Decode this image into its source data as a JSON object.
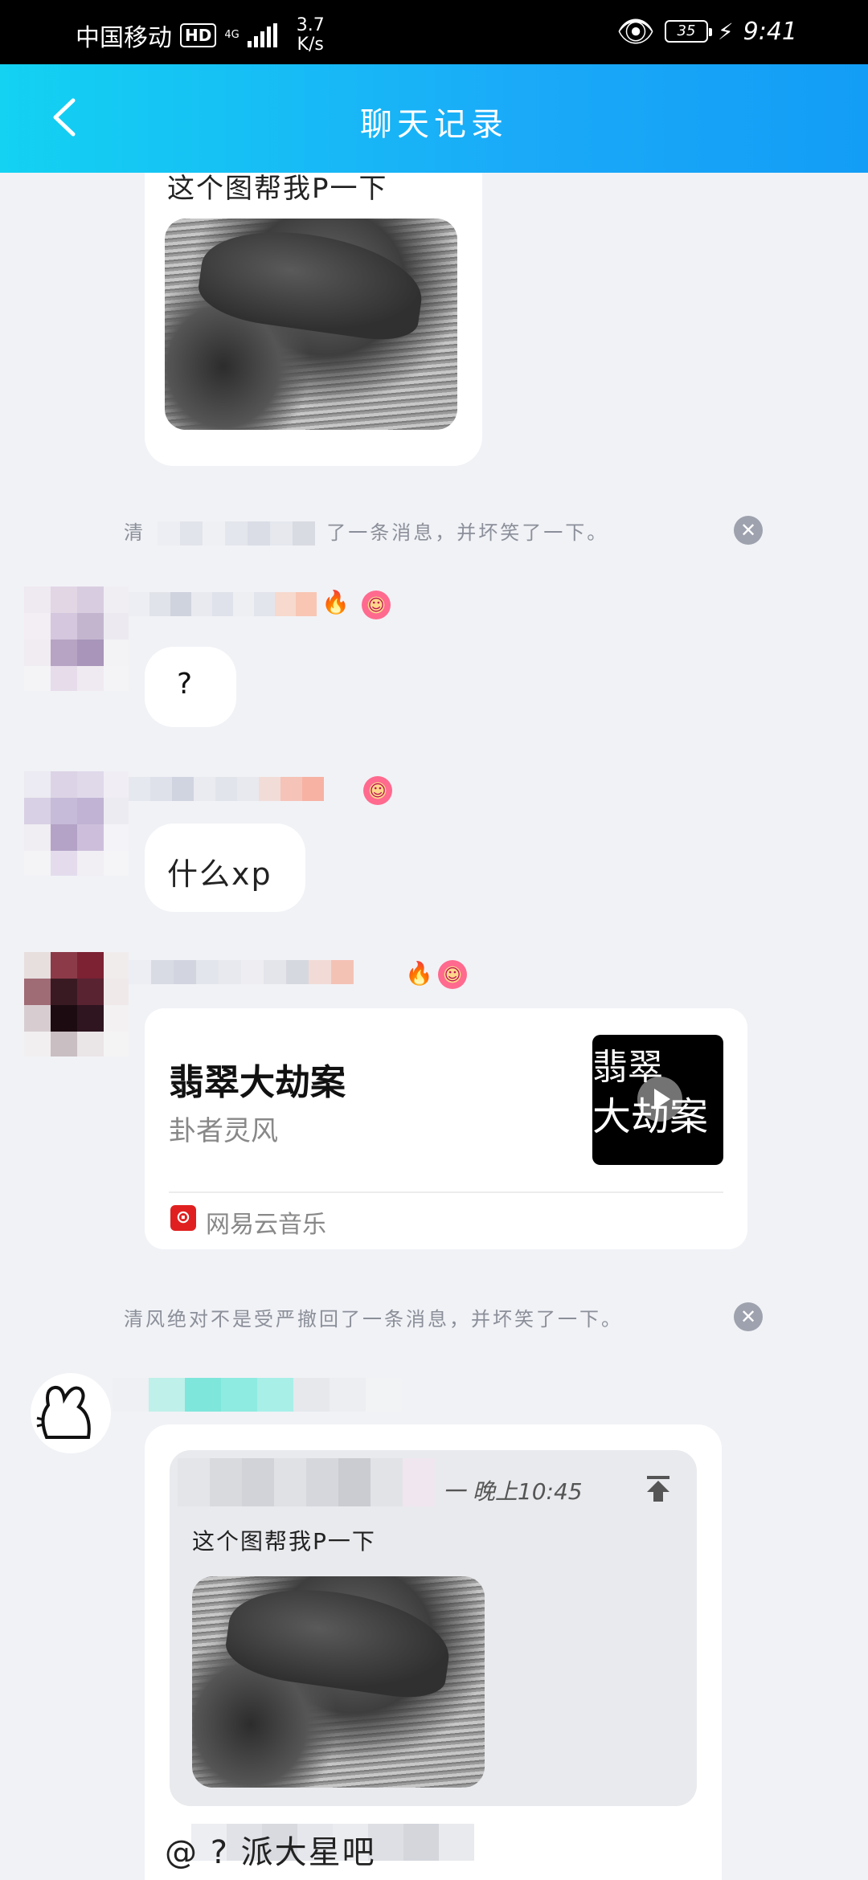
{
  "status_bar": {
    "carrier": "中国移动",
    "hd": "HD",
    "network": "4G",
    "speed_value": "3.7",
    "speed_unit": "K/s",
    "battery": "35",
    "time": "9:41"
  },
  "header": {
    "title": "聊天记录"
  },
  "messages": {
    "first_image_caption": "这个图帮我P一下",
    "recall_1": "了一条消息，并坏笑了一下。",
    "recall_1_prefix": "清",
    "msg_question": "?",
    "msg_xp": "什么xp",
    "recall_2": "清风绝对不是受严撤回了一条消息，并坏笑了一下。",
    "quote_time": "一 晚上10:45",
    "quote_caption": "这个图帮我P一下",
    "last_message": "@                      ? 派大星吧"
  },
  "music_card": {
    "title": "翡翠大劫案",
    "artist": "卦者灵风",
    "cover_line1": "翡翠",
    "cover_line2": "大劫案",
    "source": "网易云音乐",
    "source_icon": "netease-music-icon"
  },
  "colors": {
    "title_gradient_start": "#13d2f2",
    "title_gradient_end": "#139df6",
    "background": "#f1f2f6"
  }
}
